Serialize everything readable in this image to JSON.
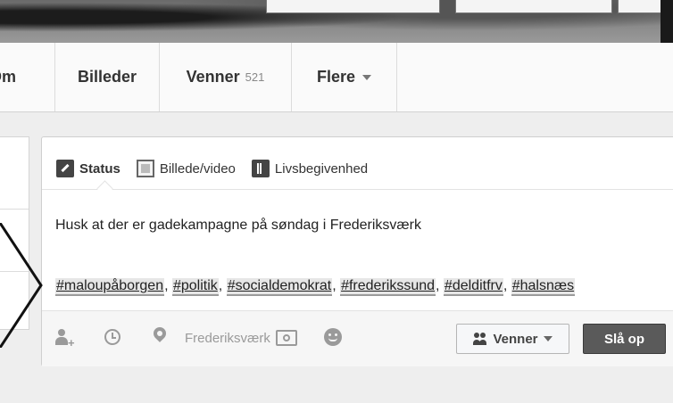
{
  "nav": {
    "om": "Om",
    "billeder": "Billeder",
    "venner_label": "Venner",
    "venner_count": "521",
    "flere": "Flere"
  },
  "composer": {
    "tabs": [
      {
        "label": "Status",
        "icon": "pencil-icon"
      },
      {
        "label": "Billede/video",
        "icon": "photo-icon"
      },
      {
        "label": "Livsbegivenhed",
        "icon": "flag-icon"
      }
    ],
    "text": "Husk at der er gadekampagne på søndag i Frederiksværk",
    "hashtags": [
      "#maloupåborgen",
      "#politik",
      "#socialdemokrat",
      "#frederikssund",
      "#delditfrv",
      "#halsnæs"
    ],
    "location": "Frederiksværk",
    "audience_label": "Venner",
    "post_label": "Slå op"
  }
}
